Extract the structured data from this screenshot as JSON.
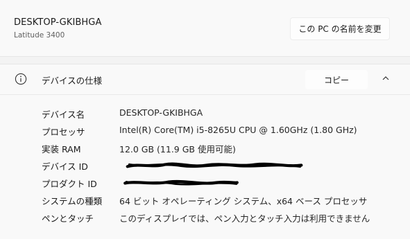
{
  "device": {
    "name": "DESKTOP-GKIBHGA",
    "model": "Latitude 3400",
    "rename_button": "この PC の名前を変更"
  },
  "spec_section": {
    "title": "デバイスの仕様",
    "copy_button": "コピー",
    "rows": [
      {
        "label": "デバイス名",
        "value": "DESKTOP-GKIBHGA"
      },
      {
        "label": "プロセッサ",
        "value": "Intel(R) Core(TM) i5-8265U CPU @ 1.60GHz (1.80 GHz)"
      },
      {
        "label": "実装 RAM",
        "value": "12.0 GB (11.9 GB 使用可能)"
      },
      {
        "label": "デバイス ID",
        "value": ""
      },
      {
        "label": "プロダクト ID",
        "value": ""
      },
      {
        "label": "システムの種類",
        "value": "64 ビット オペレーティング システム、x64 ベース プロセッサ"
      },
      {
        "label": "ペンとタッチ",
        "value": "このディスプレイでは、ペン入力とタッチ入力は利用できません"
      }
    ]
  },
  "icons": {
    "info": "info-circle-icon",
    "collapse": "chevron-up-icon"
  }
}
